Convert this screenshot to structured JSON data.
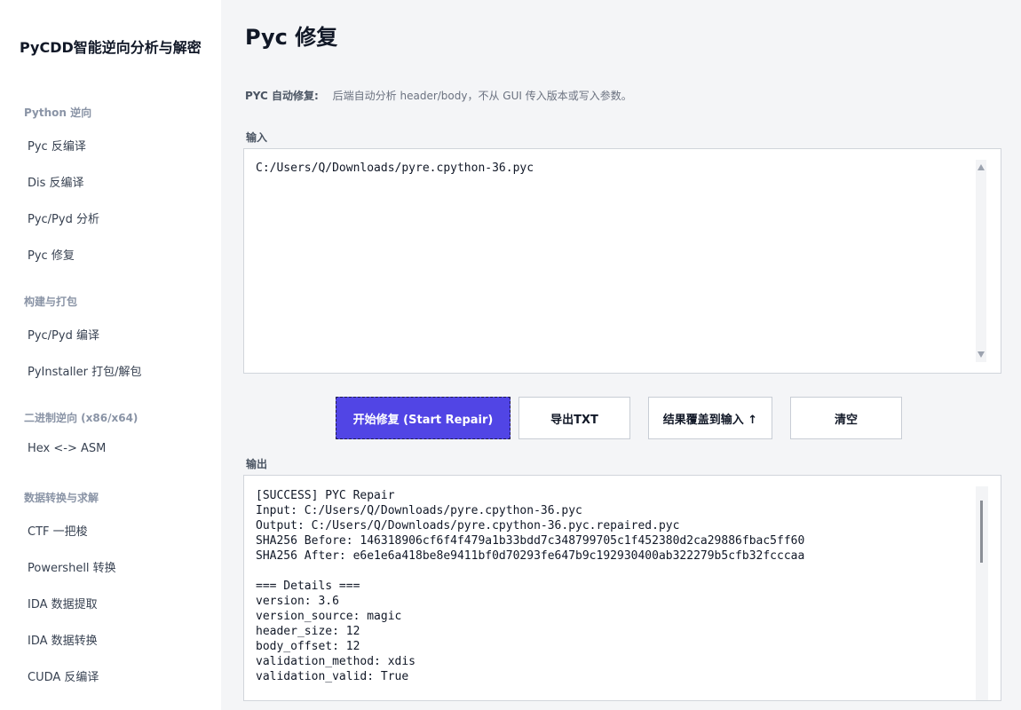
{
  "app_title": "PyCDD智能逆向分析与解密",
  "sidebar": {
    "sections": [
      {
        "title": "Python 逆向",
        "items": [
          "Pyc 反编译",
          "Dis 反编译",
          "Pyc/Pyd 分析",
          "Pyc 修复"
        ]
      },
      {
        "title": "构建与打包",
        "items": [
          "Pyc/Pyd 编译",
          "PyInstaller 打包/解包"
        ]
      },
      {
        "title": "二进制逆向 (x86/x64)",
        "items": [
          "Hex <-> ASM"
        ]
      },
      {
        "title": "数据转换与求解",
        "items": [
          "CTF 一把梭",
          "Powershell 转换",
          "IDA 数据提取",
          "IDA 数据转换",
          "CUDA 反编译"
        ]
      }
    ]
  },
  "page": {
    "title": "Pyc 修复",
    "hint_label": "PYC 自动修复:",
    "hint_text": "后端自动分析 header/body，不从 GUI 传入版本或写入参数。",
    "input_label": "输入",
    "input_value": "C:/Users/Q/Downloads/pyre.cpython-36.pyc",
    "buttons": {
      "start": "开始修复 (Start Repair)",
      "export": "导出TXT",
      "overwrite": "结果覆盖到输入 ↑",
      "clear": "清空"
    },
    "output_label": "输出",
    "output_lines": [
      "[SUCCESS] PYC Repair",
      "Input: C:/Users/Q/Downloads/pyre.cpython-36.pyc",
      "Output: C:/Users/Q/Downloads/pyre.cpython-36.pyc.repaired.pyc",
      "SHA256 Before: 146318906cf6f4f479a1b33bdd7c348799705c1f452380d2ca29886fbac5ff60",
      "SHA256 After: e6e1e6a418be8e9411bf0d70293fe647b9c192930400ab322279b5cfb32fcccaa",
      "",
      "=== Details ===",
      "version: 3.6",
      "version_source: magic",
      "header_size: 12",
      "body_offset: 12",
      "validation_method: xdis",
      "validation_valid: True"
    ]
  }
}
